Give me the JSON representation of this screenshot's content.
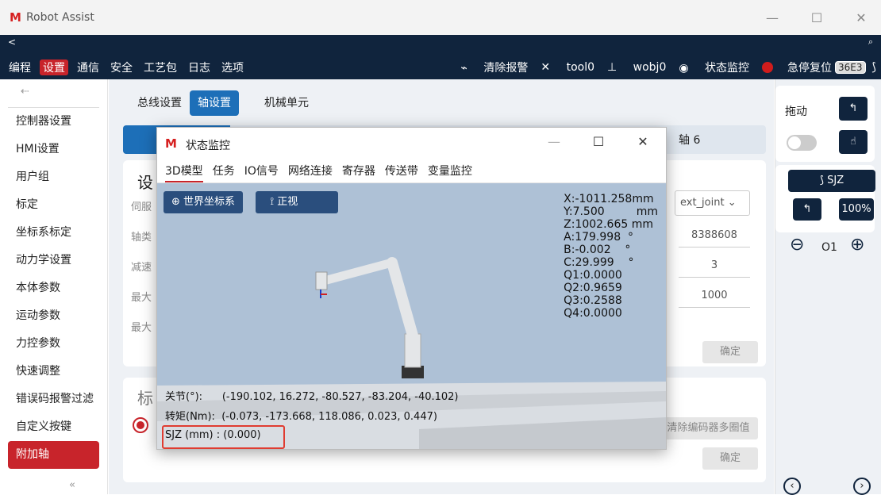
{
  "app": {
    "logo": "M",
    "title": "Robot Assist"
  },
  "window_controls": {
    "min": "—",
    "max": "☐",
    "close": "✕"
  },
  "nav": {
    "back": "<",
    "search": "⌕",
    "menu": [
      "编程",
      "设置",
      "通信",
      "安全",
      "工艺包",
      "日志",
      "选项"
    ],
    "active": "设置"
  },
  "toolbar": {
    "clear_alarm": "清除报警",
    "tool": "tool0",
    "wobj": "wobj0",
    "monitor": "状态监控",
    "estop": "急停复位",
    "code": "36E3"
  },
  "sidebar": {
    "items": [
      "控制器设置",
      "HMI设置",
      "用户组",
      "标定",
      "坐标系标定",
      "动力学设置",
      "本体参数",
      "运动参数",
      "力控参数",
      "快速调整",
      "错误码报警过滤",
      "自定义按键",
      "附加轴"
    ],
    "active": "附加轴",
    "collapse": "⇠",
    "more": "«"
  },
  "tabs": [
    "总线设置",
    "轴设置",
    "机械单元"
  ],
  "active_tab": "轴设置",
  "axis_tab": "轴 6",
  "form": {
    "heading": "设",
    "labels": [
      "伺服",
      "轴类",
      "减速",
      "最大",
      "最大"
    ],
    "select": "ext_joint",
    "values": [
      "8388608",
      "3",
      "1000"
    ],
    "confirm": "确定",
    "heading2": "标",
    "clear_encoder": "清除编码器多圈值",
    "confirm2": "确定"
  },
  "right": {
    "drag": "拖动",
    "sjz": "SJZ",
    "percent": "100%",
    "minus": "⊖",
    "plus": "⊕",
    "o1": "O1",
    "prev": "‹",
    "next": "›"
  },
  "modal": {
    "logo": "M",
    "title": "状态监控",
    "min": "—",
    "max": "☐",
    "close": "✕",
    "tabs": [
      "3D模型",
      "任务",
      "IO信号",
      "网络连接",
      "寄存器",
      "传送带",
      "变量监控"
    ],
    "active_tab": "3D模型",
    "btn_world": "世界坐标系",
    "btn_front": "正视",
    "coords": [
      "X:-1011.258mm",
      "Y:7.500",
      "mm",
      "Z:1002.665 mm",
      "A:179.998",
      "°",
      "B:-0.002",
      "°",
      "C:29.999",
      "°",
      "Q1:0.0000",
      "Q2:0.9659",
      "Q3:0.2588",
      "Q4:0.0000"
    ],
    "joint": "关节(°):",
    "joint_vals": "(-190.102, 16.272, -80.527, -83.204, -40.102)",
    "torque": "转矩(Nm):",
    "torque_vals": "(-0.073, -173.668, 118.086, 0.023, 0.447)",
    "sjz": "SJZ (mm) :",
    "sjz_val": "(0.000)"
  }
}
